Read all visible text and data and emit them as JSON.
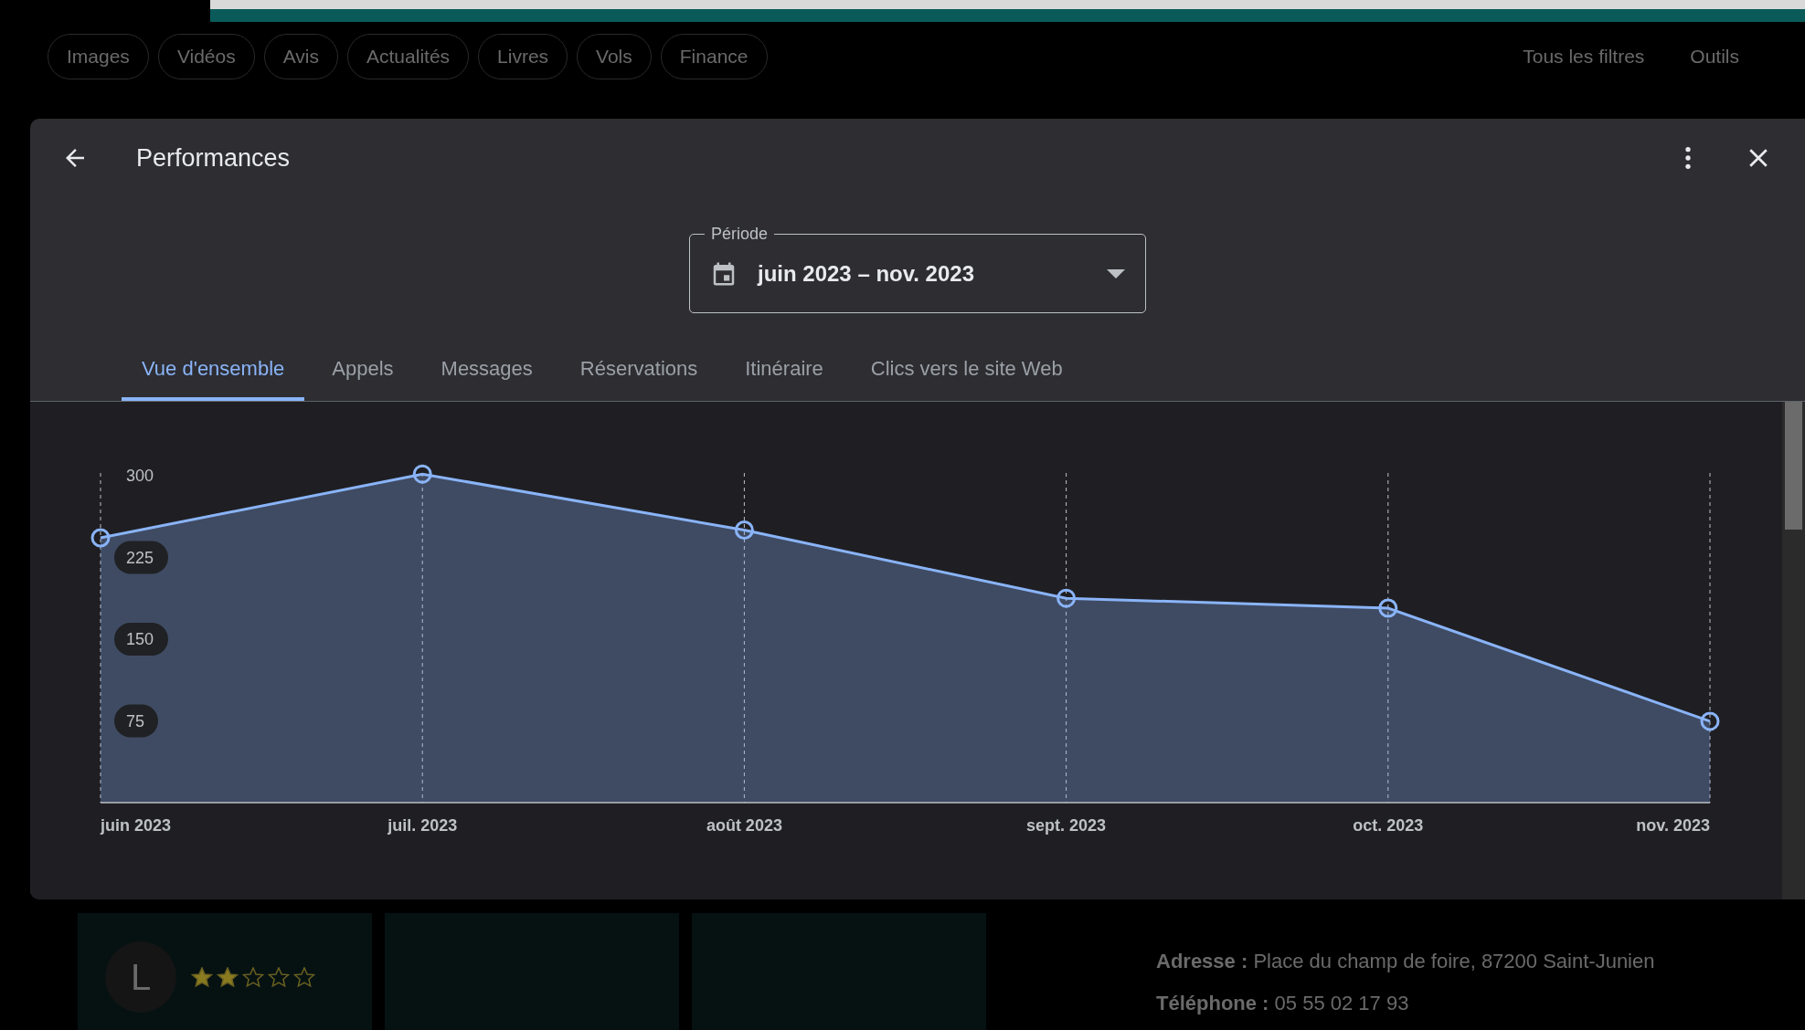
{
  "background": {
    "chips": [
      "Images",
      "Vidéos",
      "Avis",
      "Actualités",
      "Livres",
      "Vols",
      "Finance"
    ],
    "filters": "Tous les filtres",
    "tools": "Outils",
    "review": {
      "avatar": "L",
      "stars": 2
    },
    "address": {
      "label": "Adresse :",
      "value": "Place du champ de foire, 87200 Saint-Junien"
    },
    "phone": {
      "label": "Téléphone :",
      "value": "05 55 02 17 93"
    }
  },
  "dialog": {
    "title": "Performances",
    "period": {
      "label": "Période",
      "value": "juin 2023 – nov. 2023"
    },
    "tabs": [
      {
        "label": "Vue d'ensemble",
        "selected": true
      },
      {
        "label": "Appels",
        "selected": false
      },
      {
        "label": "Messages",
        "selected": false
      },
      {
        "label": "Réservations",
        "selected": false
      },
      {
        "label": "Itinéraire",
        "selected": false
      },
      {
        "label": "Clics vers le site Web",
        "selected": false
      }
    ],
    "chart_data": {
      "type": "area",
      "categories": [
        "juin 2023",
        "juil. 2023",
        "août 2023",
        "sept. 2023",
        "oct. 2023",
        "nov. 2023"
      ],
      "series": [
        {
          "color": "#8ab4f8",
          "values": [
            241,
            299,
            248,
            186,
            177,
            74
          ]
        }
      ],
      "ylim": [
        0,
        300
      ],
      "yticks": [
        75,
        150,
        225,
        300
      ],
      "grid": true
    }
  }
}
